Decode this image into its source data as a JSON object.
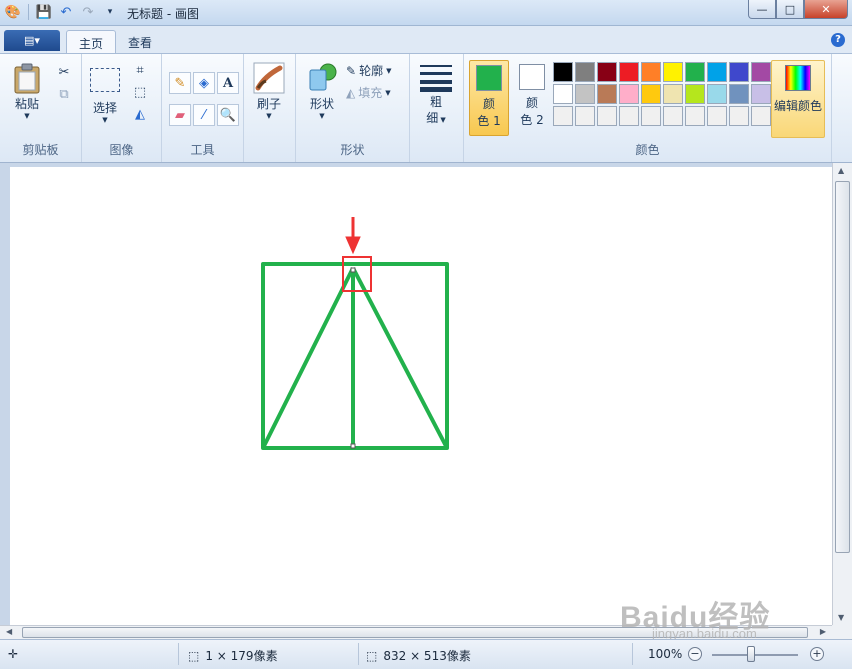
{
  "window": {
    "title": "无标题 - 画图",
    "controls": {
      "minimize": "—",
      "maximize": "□",
      "close": "✕"
    }
  },
  "tabs": {
    "app_menu": "▤▾",
    "items": [
      "主页",
      "查看"
    ],
    "active": "主页",
    "help": "?"
  },
  "ribbon": {
    "clipboard": {
      "group": "剪贴板",
      "paste": "粘贴"
    },
    "image": {
      "group": "图像",
      "select": "选择"
    },
    "tools": {
      "group": "工具",
      "text_tool": "A"
    },
    "brushes": {
      "label": "刷子"
    },
    "shapes": {
      "group": "形状",
      "shapes": "形状",
      "outline": "轮廓",
      "fill": "填充"
    },
    "size": {
      "label_line1": "粗",
      "label_line2": "细"
    },
    "colors": {
      "group": "颜色",
      "color1": {
        "line1": "颜",
        "line2": "色 1",
        "value": "#22b14c"
      },
      "color2": {
        "line1": "颜",
        "line2": "色 2",
        "value": "#ffffff"
      },
      "edit": "编辑颜色",
      "palette_row1": [
        "#000000",
        "#7f7f7f",
        "#880015",
        "#ed1c24",
        "#ff7f27",
        "#fff200",
        "#22b14c",
        "#00a2e8",
        "#3f48cc",
        "#a349a4"
      ],
      "palette_row2": [
        "#ffffff",
        "#c3c3c3",
        "#b97a57",
        "#ffaec9",
        "#ffc90e",
        "#efe4b0",
        "#b5e61d",
        "#99d9ea",
        "#7092be",
        "#c8bfe7"
      ],
      "palette_row3": [
        "#f0f0f0",
        "#f0f0f0",
        "#f0f0f0",
        "#f0f0f0",
        "#f0f0f0",
        "#f0f0f0",
        "#f0f0f0",
        "#f0f0f0",
        "#f0f0f0",
        "#f0f0f0"
      ]
    }
  },
  "drawing": {
    "stroke_color": "#22b14c",
    "marker_color": "#ee3333"
  },
  "status": {
    "cursor_icon": "✛",
    "selection_size": "1 × 179像素",
    "canvas_size": "832 × 513像素",
    "zoom": "100%",
    "zoom_level": 1.0
  },
  "watermark": {
    "brand": "Baidu经验",
    "url": "jingyan.baidu.com"
  }
}
